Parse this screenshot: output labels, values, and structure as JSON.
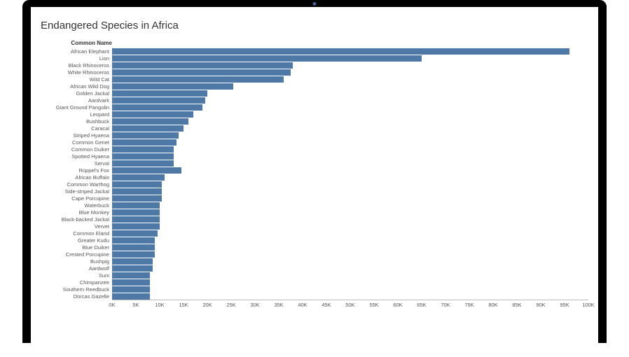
{
  "title": "Endangered Species in Africa",
  "axis_header": "Common Name",
  "chart_data": {
    "type": "bar",
    "title": "Endangered Species in Africa",
    "xlabel": "",
    "ylabel": "Common Name",
    "xlim": [
      0,
      100000
    ],
    "categories": [
      "African Elephant",
      "Lion",
      "Black Rhinoceros",
      "White Rhinoceros",
      "Wild Cat",
      "African Wild Dog",
      "Golden Jackal",
      "Aardvark",
      "Giant Ground Pangolin",
      "Leopard",
      "Bushbuck",
      "Caracal",
      "Striped Hyaena",
      "Common Genet",
      "Common Duiker",
      "Spotted Hyaena",
      "Serval",
      "Rüppel's Fox",
      "African Buffalo",
      "Common Warthog",
      "Side-striped Jackal",
      "Cape Porcupine",
      "Waterbuck",
      "Blue Monkey",
      "Black-backed Jackal",
      "Vervet",
      "Common Eland",
      "Greater Kudu",
      "Blue Duiker",
      "Crested Porcupine",
      "Bushpig",
      "Aardwolf",
      "Suni",
      "Chimpanzee",
      "Southern Reedbuck",
      "Dorcas Gazelle"
    ],
    "values": [
      96000,
      65000,
      38000,
      37500,
      36000,
      25500,
      20000,
      19500,
      19000,
      17000,
      16000,
      15000,
      14000,
      13500,
      13000,
      13000,
      13000,
      14500,
      11000,
      10500,
      10500,
      10500,
      10000,
      10000,
      10000,
      10000,
      9500,
      9000,
      9000,
      9000,
      8500,
      8500,
      8000,
      8000,
      8000,
      8000
    ],
    "ticks": [
      0,
      5000,
      10000,
      15000,
      20000,
      25000,
      30000,
      35000,
      40000,
      45000,
      50000,
      55000,
      60000,
      65000,
      70000,
      75000,
      80000,
      85000,
      90000,
      95000,
      100000
    ],
    "tick_labels": [
      "0K",
      "5K",
      "10K",
      "15K",
      "20K",
      "25K",
      "30K",
      "35K",
      "40K",
      "45K",
      "50K",
      "55K",
      "60K",
      "65K",
      "70K",
      "75K",
      "80K",
      "85K",
      "90K",
      "95K",
      "100K"
    ]
  }
}
